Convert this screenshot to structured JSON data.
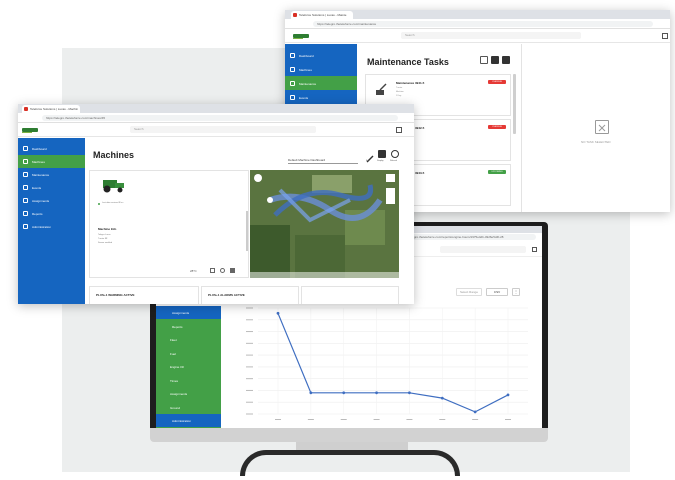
{
  "machines_window": {
    "tab_title": "Teleforce Solutions | Lucas - Machin",
    "url": "https://telegro.theteleforce.com/machines/45",
    "search_placeholder": "Search",
    "page_title": "Machines",
    "dashboard_caption": "Default Machine Dashboard",
    "toolbar": [
      "Edit",
      "Display",
      "Refresh"
    ],
    "machine_status": "Last data received 8 hrs",
    "machine_info_title": "Machine Info",
    "machine_info_lines": [
      "Telegro Lucas",
      "Tractor 8R",
      "Sensor enabled"
    ],
    "machine_stats": [
      "28°C"
    ],
    "widgets": [
      "PLUS+1 WARNING ACTIVE",
      "PLUS+1 ALARMS ACTIVE"
    ],
    "sidebar": [
      "Dashboard",
      "Machines",
      "Maintenance",
      "Events",
      "Assignments",
      "Reports",
      "Administration"
    ],
    "active_sidebar": "Machines"
  },
  "maintenance_window": {
    "tab_title": "Teleforce Solutions | Lucas - Mainte",
    "url": "https://telegro.theteleforce.com/maintenance",
    "search_placeholder": "Search",
    "page_title": "Maintenance Tasks",
    "sidebar": [
      "Dashboard",
      "Machines",
      "Maintenance",
      "Events"
    ],
    "active_sidebar": "Maintenance",
    "tasks": [
      {
        "title": "Maintenance 3941-5",
        "lines": [
          "Tractor",
          "Machine",
          "1 Day"
        ],
        "badge": "OVERDUE",
        "badge_color": "#e53935"
      },
      {
        "title": "Maintenance 3942-5",
        "lines": [
          "Tractor",
          "Machine"
        ],
        "badge": "OVERDUE",
        "badge_color": "#e53935"
      },
      {
        "title": "Maintenance 3943-5",
        "lines": [
          "Tractor"
        ],
        "badge": "UPCOMING",
        "badge_color": "#43a047"
      }
    ],
    "empty_state": "NO TASK SELECTED"
  },
  "monitor_window": {
    "url": "https://telegro.theteleforce.com/reports/engine-hours/1975e4db-4926e5d4f-28",
    "sidebar": [
      "Assignments",
      "Reports",
      "Fleet",
      "Fuel",
      "Engine Oil",
      "Times",
      "Assignments",
      "Ground",
      "Administration"
    ],
    "sidebar_colors": {
      "assignments": "#1565c0",
      "reports": "#43a047"
    },
    "controls": [
      "Select Range",
      "CSV",
      "⋮"
    ]
  },
  "chart_data": {
    "type": "line",
    "x": [
      1,
      2,
      3,
      4,
      5,
      6,
      7,
      8
    ],
    "y_relative_to_plot_height": [
      0.95,
      0.2,
      0.2,
      0.2,
      0.2,
      0.15,
      0.02,
      0.18
    ],
    "title": "",
    "xlabel": "",
    "ylabel": "",
    "grid": true,
    "color": "#3f6ec1"
  },
  "colors": {
    "primary_blue": "#1565c0",
    "accent_green": "#43a047",
    "overdue_red": "#e53935"
  }
}
